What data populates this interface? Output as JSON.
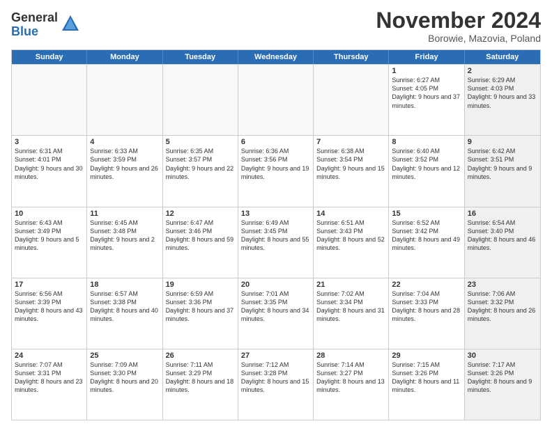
{
  "logo": {
    "line1": "General",
    "line2": "Blue"
  },
  "title": "November 2024",
  "location": "Borowie, Mazovia, Poland",
  "days_of_week": [
    "Sunday",
    "Monday",
    "Tuesday",
    "Wednesday",
    "Thursday",
    "Friday",
    "Saturday"
  ],
  "rows": [
    [
      {
        "day": "",
        "info": "",
        "empty": true
      },
      {
        "day": "",
        "info": "",
        "empty": true
      },
      {
        "day": "",
        "info": "",
        "empty": true
      },
      {
        "day": "",
        "info": "",
        "empty": true
      },
      {
        "day": "",
        "info": "",
        "empty": true
      },
      {
        "day": "1",
        "info": "Sunrise: 6:27 AM\nSunset: 4:05 PM\nDaylight: 9 hours and 37 minutes.",
        "empty": false
      },
      {
        "day": "2",
        "info": "Sunrise: 6:29 AM\nSunset: 4:03 PM\nDaylight: 9 hours and 33 minutes.",
        "empty": false,
        "shaded": true
      }
    ],
    [
      {
        "day": "3",
        "info": "Sunrise: 6:31 AM\nSunset: 4:01 PM\nDaylight: 9 hours and 30 minutes.",
        "empty": false
      },
      {
        "day": "4",
        "info": "Sunrise: 6:33 AM\nSunset: 3:59 PM\nDaylight: 9 hours and 26 minutes.",
        "empty": false
      },
      {
        "day": "5",
        "info": "Sunrise: 6:35 AM\nSunset: 3:57 PM\nDaylight: 9 hours and 22 minutes.",
        "empty": false
      },
      {
        "day": "6",
        "info": "Sunrise: 6:36 AM\nSunset: 3:56 PM\nDaylight: 9 hours and 19 minutes.",
        "empty": false
      },
      {
        "day": "7",
        "info": "Sunrise: 6:38 AM\nSunset: 3:54 PM\nDaylight: 9 hours and 15 minutes.",
        "empty": false
      },
      {
        "day": "8",
        "info": "Sunrise: 6:40 AM\nSunset: 3:52 PM\nDaylight: 9 hours and 12 minutes.",
        "empty": false
      },
      {
        "day": "9",
        "info": "Sunrise: 6:42 AM\nSunset: 3:51 PM\nDaylight: 9 hours and 9 minutes.",
        "empty": false,
        "shaded": true
      }
    ],
    [
      {
        "day": "10",
        "info": "Sunrise: 6:43 AM\nSunset: 3:49 PM\nDaylight: 9 hours and 5 minutes.",
        "empty": false
      },
      {
        "day": "11",
        "info": "Sunrise: 6:45 AM\nSunset: 3:48 PM\nDaylight: 9 hours and 2 minutes.",
        "empty": false
      },
      {
        "day": "12",
        "info": "Sunrise: 6:47 AM\nSunset: 3:46 PM\nDaylight: 8 hours and 59 minutes.",
        "empty": false
      },
      {
        "day": "13",
        "info": "Sunrise: 6:49 AM\nSunset: 3:45 PM\nDaylight: 8 hours and 55 minutes.",
        "empty": false
      },
      {
        "day": "14",
        "info": "Sunrise: 6:51 AM\nSunset: 3:43 PM\nDaylight: 8 hours and 52 minutes.",
        "empty": false
      },
      {
        "day": "15",
        "info": "Sunrise: 6:52 AM\nSunset: 3:42 PM\nDaylight: 8 hours and 49 minutes.",
        "empty": false
      },
      {
        "day": "16",
        "info": "Sunrise: 6:54 AM\nSunset: 3:40 PM\nDaylight: 8 hours and 46 minutes.",
        "empty": false,
        "shaded": true
      }
    ],
    [
      {
        "day": "17",
        "info": "Sunrise: 6:56 AM\nSunset: 3:39 PM\nDaylight: 8 hours and 43 minutes.",
        "empty": false
      },
      {
        "day": "18",
        "info": "Sunrise: 6:57 AM\nSunset: 3:38 PM\nDaylight: 8 hours and 40 minutes.",
        "empty": false
      },
      {
        "day": "19",
        "info": "Sunrise: 6:59 AM\nSunset: 3:36 PM\nDaylight: 8 hours and 37 minutes.",
        "empty": false
      },
      {
        "day": "20",
        "info": "Sunrise: 7:01 AM\nSunset: 3:35 PM\nDaylight: 8 hours and 34 minutes.",
        "empty": false
      },
      {
        "day": "21",
        "info": "Sunrise: 7:02 AM\nSunset: 3:34 PM\nDaylight: 8 hours and 31 minutes.",
        "empty": false
      },
      {
        "day": "22",
        "info": "Sunrise: 7:04 AM\nSunset: 3:33 PM\nDaylight: 8 hours and 28 minutes.",
        "empty": false
      },
      {
        "day": "23",
        "info": "Sunrise: 7:06 AM\nSunset: 3:32 PM\nDaylight: 8 hours and 26 minutes.",
        "empty": false,
        "shaded": true
      }
    ],
    [
      {
        "day": "24",
        "info": "Sunrise: 7:07 AM\nSunset: 3:31 PM\nDaylight: 8 hours and 23 minutes.",
        "empty": false
      },
      {
        "day": "25",
        "info": "Sunrise: 7:09 AM\nSunset: 3:30 PM\nDaylight: 8 hours and 20 minutes.",
        "empty": false
      },
      {
        "day": "26",
        "info": "Sunrise: 7:11 AM\nSunset: 3:29 PM\nDaylight: 8 hours and 18 minutes.",
        "empty": false
      },
      {
        "day": "27",
        "info": "Sunrise: 7:12 AM\nSunset: 3:28 PM\nDaylight: 8 hours and 15 minutes.",
        "empty": false
      },
      {
        "day": "28",
        "info": "Sunrise: 7:14 AM\nSunset: 3:27 PM\nDaylight: 8 hours and 13 minutes.",
        "empty": false
      },
      {
        "day": "29",
        "info": "Sunrise: 7:15 AM\nSunset: 3:26 PM\nDaylight: 8 hours and 11 minutes.",
        "empty": false
      },
      {
        "day": "30",
        "info": "Sunrise: 7:17 AM\nSunset: 3:26 PM\nDaylight: 8 hours and 9 minutes.",
        "empty": false,
        "shaded": true
      }
    ]
  ]
}
